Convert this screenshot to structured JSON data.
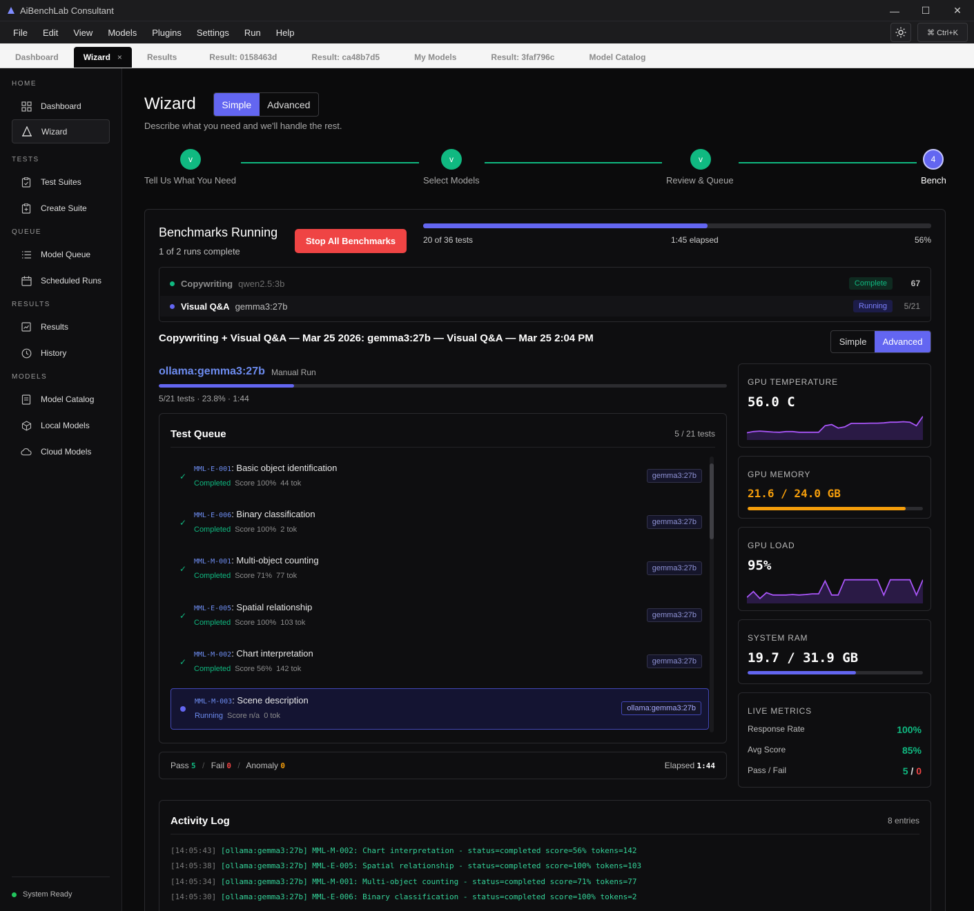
{
  "window": {
    "title": "AiBenchLab Consultant",
    "min": "—",
    "max": "☐",
    "close": "✕"
  },
  "menu": {
    "items": [
      "File",
      "Edit",
      "View",
      "Models",
      "Plugins",
      "Settings",
      "Run",
      "Help"
    ],
    "shortcut": "⌘ Ctrl+K"
  },
  "tabs": [
    "Dashboard",
    "Wizard",
    "Results",
    "Result: 0158463d",
    "Result: ca48b7d5",
    "My Models",
    "Result: 3faf796c",
    "Model Catalog"
  ],
  "tab_close": "×",
  "sidebar": {
    "sections": [
      {
        "title": "HOME",
        "items": [
          "Dashboard",
          "Wizard"
        ]
      },
      {
        "title": "TESTS",
        "items": [
          "Test Suites",
          "Create Suite"
        ]
      },
      {
        "title": "QUEUE",
        "items": [
          "Model Queue",
          "Scheduled Runs"
        ]
      },
      {
        "title": "RESULTS",
        "items": [
          "Results",
          "History"
        ]
      },
      {
        "title": "MODELS",
        "items": [
          "Model Catalog",
          "Local Models",
          "Cloud Models"
        ]
      }
    ],
    "status": "System Ready"
  },
  "header": {
    "title": "Wizard",
    "mode_simple": "Simple",
    "mode_advanced": "Advanced",
    "subtitle": "Describe what you need and we'll handle the rest."
  },
  "steps": [
    {
      "label": "Tell Us What You Need",
      "mark": "v"
    },
    {
      "label": "Select Models",
      "mark": "v"
    },
    {
      "label": "Review & Queue",
      "mark": "v"
    },
    {
      "label": "Bench",
      "mark": "4"
    }
  ],
  "bench": {
    "title": "Benchmarks Running",
    "subtitle": "1 of 2 runs complete",
    "stop_label": "Stop All Benchmarks",
    "progress_text": "20 of 36 tests",
    "elapsed": "1:45 elapsed",
    "percent": "56%",
    "progress_value": 0.56,
    "runs": [
      {
        "suite": "Copywriting",
        "model": "qwen2.5:3b",
        "status": "Complete",
        "value": "67",
        "color": "#10b981"
      },
      {
        "suite": "Visual Q&A",
        "model": "gemma3:27b",
        "status": "Running",
        "value": "5/21",
        "color": "#6366f1"
      }
    ]
  },
  "run": {
    "title": "Copywriting + Visual Q&A — Mar 25 2026: gemma3:27b — Visual Q&A — Mar 25 2:04 PM",
    "view_simple": "Simple",
    "view_advanced": "Advanced",
    "model": "ollama:gemma3:27b",
    "mode": "Manual Run",
    "progress_value": 0.238,
    "stats": "5/21 tests · 23.8% · 1:44"
  },
  "queue": {
    "title": "Test Queue",
    "count": "5 / 21 tests",
    "items": [
      {
        "id": "MML-E-001",
        "name": ": Basic object identification",
        "status": "Completed",
        "score": "Score 100%",
        "tok": "44 tok",
        "model": "gemma3:27b"
      },
      {
        "id": "MML-E-006",
        "name": ": Binary classification",
        "status": "Completed",
        "score": "Score 100%",
        "tok": "2 tok",
        "model": "gemma3:27b"
      },
      {
        "id": "MML-M-001",
        "name": ": Multi-object counting",
        "status": "Completed",
        "score": "Score 71%",
        "tok": "77 tok",
        "model": "gemma3:27b"
      },
      {
        "id": "MML-E-005",
        "name": ": Spatial relationship",
        "status": "Completed",
        "score": "Score 100%",
        "tok": "103 tok",
        "model": "gemma3:27b"
      },
      {
        "id": "MML-M-002",
        "name": ": Chart interpretation",
        "status": "Completed",
        "score": "Score 56%",
        "tok": "142 tok",
        "model": "gemma3:27b"
      },
      {
        "id": "MML-M-003",
        "name": ": Scene description",
        "status": "Running",
        "score": "Score n/a",
        "tok": "0 tok",
        "model": "ollama:gemma3:27b"
      }
    ],
    "check": "✓"
  },
  "summary": {
    "pass_label": "Pass",
    "pass": "5",
    "fail_label": "Fail",
    "fail": "0",
    "anomaly_label": "Anomaly",
    "anomaly": "0",
    "elapsed_label": "Elapsed",
    "elapsed": "1:44",
    "sep": "/"
  },
  "metrics": {
    "gpu_temp": {
      "label": "GPU TEMPERATURE",
      "value": "56.0 C",
      "series": [
        0.25,
        0.3,
        0.32,
        0.3,
        0.28,
        0.27,
        0.3,
        0.3,
        0.27,
        0.27,
        0.27,
        0.27,
        0.55,
        0.6,
        0.45,
        0.5,
        0.65,
        0.65,
        0.65,
        0.66,
        0.66,
        0.67,
        0.7,
        0.7,
        0.72,
        0.7,
        0.55,
        0.95
      ]
    },
    "gpu_mem": {
      "label": "GPU MEMORY",
      "value": "21.6 / 24.0 GB",
      "fill": 0.9
    },
    "gpu_load": {
      "label": "GPU LOAD",
      "value": "95%",
      "series": [
        0.2,
        0.45,
        0.15,
        0.4,
        0.3,
        0.3,
        0.3,
        0.32,
        0.3,
        0.32,
        0.35,
        0.35,
        0.9,
        0.3,
        0.3,
        0.95,
        0.95,
        0.95,
        0.95,
        0.95,
        0.95,
        0.3,
        0.95,
        0.95,
        0.95,
        0.95,
        0.3,
        0.95
      ]
    },
    "ram": {
      "label": "SYSTEM RAM",
      "value": "19.7 / 31.9 GB",
      "fill": 0.617
    },
    "live": {
      "label": "LIVE METRICS",
      "rows": [
        {
          "k": "Response Rate",
          "v": "100%"
        },
        {
          "k": "Avg Score",
          "v": "85%"
        },
        {
          "k": "Pass / Fail",
          "pass": "5",
          "sep": " / ",
          "fail": "0"
        }
      ]
    }
  },
  "log": {
    "title": "Activity Log",
    "count": "8 entries",
    "lines": [
      {
        "ts": "[14:05:43]",
        "msg": " [ollama:gemma3:27b] MML-M-002: Chart interpretation - status=completed score=56% tokens=142"
      },
      {
        "ts": "[14:05:38]",
        "msg": " [ollama:gemma3:27b] MML-E-005: Spatial relationship - status=completed score=100% tokens=103"
      },
      {
        "ts": "[14:05:34]",
        "msg": " [ollama:gemma3:27b] MML-M-001: Multi-object counting - status=completed score=71% tokens=77"
      },
      {
        "ts": "[14:05:30]",
        "msg": " [ollama:gemma3:27b] MML-E-006: Binary classification - status=completed score=100% tokens=2"
      }
    ]
  },
  "colors": {
    "accent": "#6366f1",
    "success": "#10b981",
    "danger": "#ef4444",
    "warning": "#f59e0b"
  }
}
